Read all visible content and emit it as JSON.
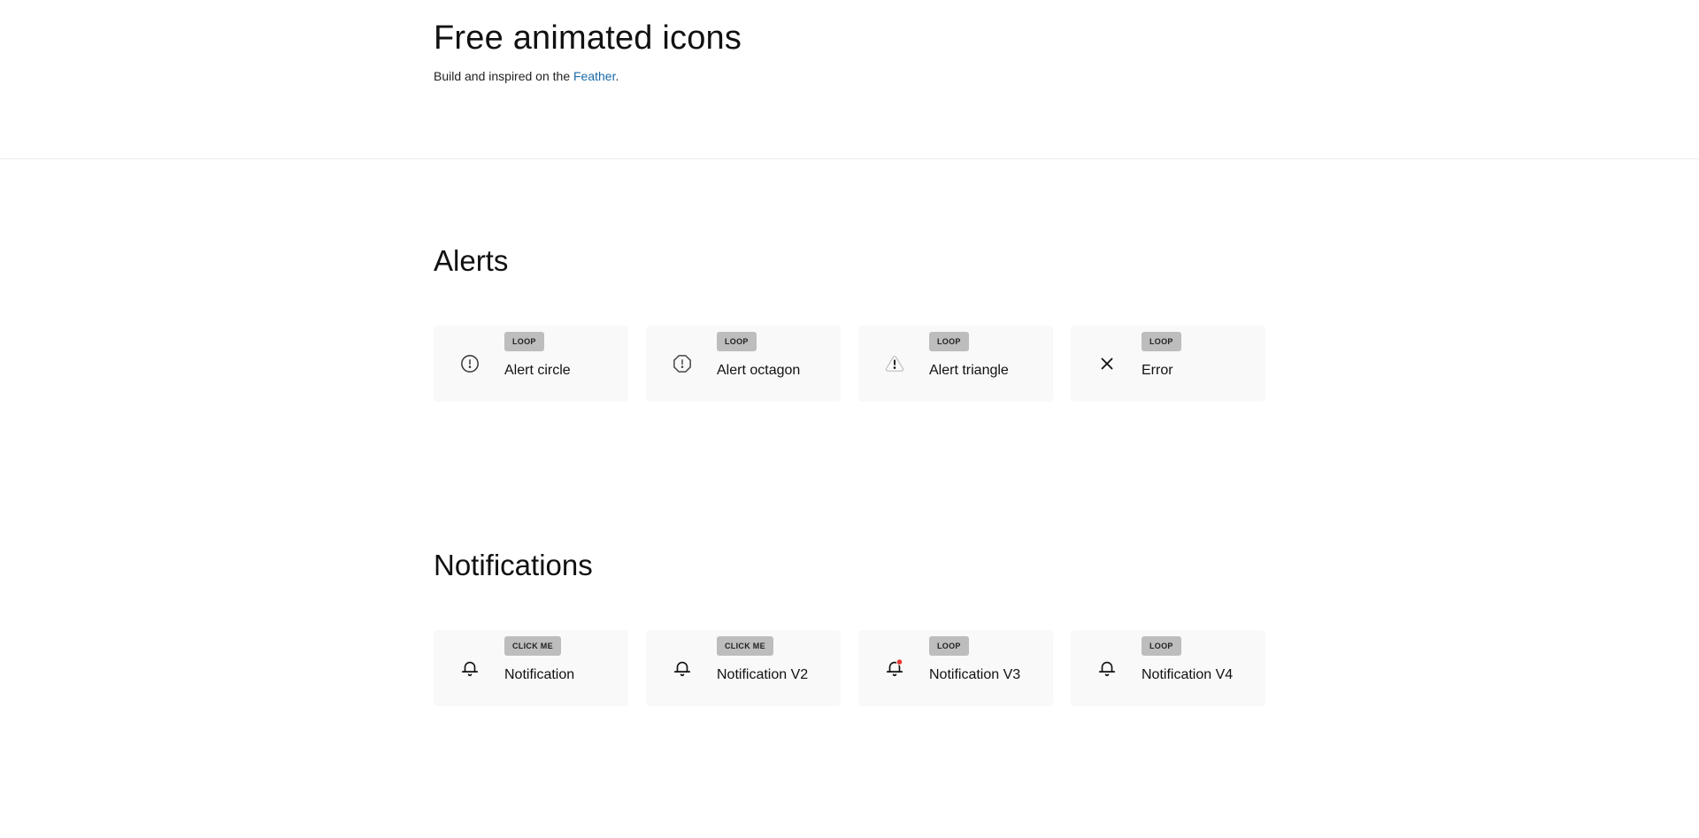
{
  "hero": {
    "title": "Free animated icons",
    "subtitle_prefix": "Build and inspired on the ",
    "link_text": "Feather",
    "subtitle_suffix": "."
  },
  "sections": [
    {
      "title": "Alerts",
      "cards": [
        {
          "badge": "LOOP",
          "label": "Alert circle",
          "icon": "alert-circle-icon"
        },
        {
          "badge": "LOOP",
          "label": "Alert octagon",
          "icon": "alert-octagon-icon"
        },
        {
          "badge": "LOOP",
          "label": "Alert triangle",
          "icon": "alert-triangle-icon"
        },
        {
          "badge": "LOOP",
          "label": "Error",
          "icon": "x-icon"
        }
      ]
    },
    {
      "title": "Notifications",
      "cards": [
        {
          "badge": "CLICK ME",
          "label": "Notification",
          "icon": "bell-icon"
        },
        {
          "badge": "CLICK ME",
          "label": "Notification V2",
          "icon": "bell-icon"
        },
        {
          "badge": "LOOP",
          "label": "Notification V3",
          "icon": "bell-dot-icon"
        },
        {
          "badge": "LOOP",
          "label": "Notification V4",
          "icon": "bell-icon"
        }
      ]
    }
  ],
  "colors": {
    "link": "#1a6aa8",
    "badge_bg": "#bdbdbd",
    "card_bg": "#f9f9f9",
    "notification_dot": "#e53935"
  }
}
